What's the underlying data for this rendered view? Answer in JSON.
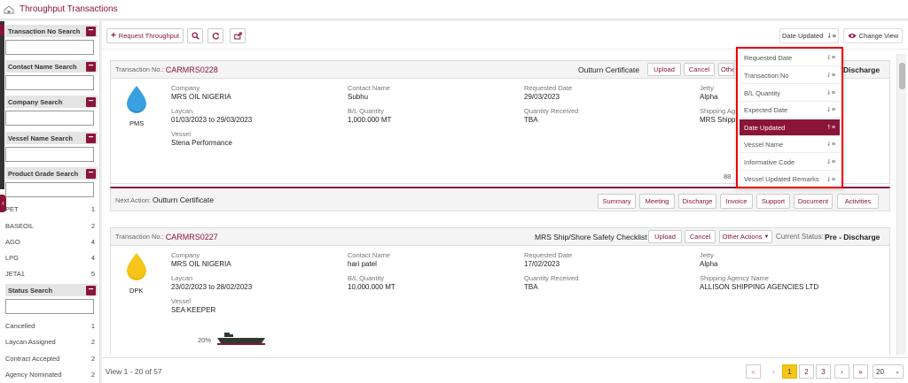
{
  "header": {
    "title": "Throughput Transactions"
  },
  "sidebar": {
    "filters": [
      {
        "label": "Transaction No Search"
      },
      {
        "label": "Contact Name Search"
      },
      {
        "label": "Company Search"
      },
      {
        "label": "Vessel Name Search"
      },
      {
        "label": "Product Grade Search"
      }
    ],
    "products": [
      {
        "name": "PET",
        "count": "1"
      },
      {
        "name": "BASEOIL",
        "count": "2"
      },
      {
        "name": "AGO",
        "count": "4"
      },
      {
        "name": "LPG",
        "count": "4"
      },
      {
        "name": "JETA1",
        "count": "5"
      }
    ],
    "status_search_label": "Status Search",
    "statuses": [
      {
        "name": "Cancelled",
        "count": "1"
      },
      {
        "name": "Laycan Assigned",
        "count": "2"
      },
      {
        "name": "Contract Accepted",
        "count": "2"
      },
      {
        "name": "Agency Nominated",
        "count": "2"
      }
    ]
  },
  "toolbar": {
    "request_label": "Request Throughput",
    "date_updated_label": "Date Updated",
    "change_view_label": "Change View"
  },
  "sort_menu": {
    "items": [
      {
        "label": "Requested Date"
      },
      {
        "label": "Transaction No"
      },
      {
        "label": "B/L Quantity"
      },
      {
        "label": "Expected Date"
      },
      {
        "label": "Date Updated"
      },
      {
        "label": "Vessel Name"
      },
      {
        "label": "Informative Code"
      },
      {
        "label": "Vessel Updated Remarks"
      }
    ]
  },
  "labels": {
    "transaction_no": "Transaction No.:",
    "company": "Company",
    "contact_name": "Contact Name",
    "requested_date": "Requested Date",
    "jetty": "Jetty",
    "laycan": "Laycan",
    "bl_quantity": "B/L Quantity",
    "quantity_received": "Quantity Received",
    "shipping_agency": "Shipping Agency Name",
    "shipping_agency_cut": "Shipping Ag",
    "vessel": "Vessel",
    "upload": "Upload",
    "cancel": "Cancel",
    "other": "Othe",
    "other_actions": "Other Actions",
    "current_status": "Current Status:",
    "next_action": "Next Action:"
  },
  "transactions": [
    {
      "tx_no": "CARMRS0228",
      "product": "PMS",
      "drop_color": "#3aa0e0",
      "company": "MRS OIL NIGERIA",
      "contact": "Subhu",
      "requested_date": "29/03/2023",
      "jetty": "Alpha",
      "laycan": "01/03/2023 to 29/03/2023",
      "bl_quantity": "1,000.000 MT",
      "quantity_received": "TBA",
      "shipping_agency": "MRS Shipp",
      "vessel": "Stena Performance",
      "action_title": "Outturn Certificate",
      "status_tail": "Discharge",
      "progress_text": "88",
      "next_action": "Outturn Certificate"
    },
    {
      "tx_no": "CARMRS0227",
      "product": "DPK",
      "drop_color": "#f5c518",
      "company": "MRS OIL NIGERIA",
      "contact": "hari patel",
      "requested_date": "17/02/2023",
      "jetty": "Alpha",
      "laycan": "23/02/2023 to 28/02/2023",
      "bl_quantity": "10,000.000 MT",
      "quantity_received": "TBA",
      "shipping_agency": "ALLISON SHIPPING AGENCIES LTD",
      "vessel": "SEA KEEPER",
      "action_title": "MRS Ship/Shore Safety Checklist",
      "status_value": "Pre - Discharge",
      "progress_text": "20%"
    }
  ],
  "action_buttons": [
    "Summary",
    "Meeting",
    "Discharge",
    "Invoice",
    "Support",
    "Document",
    "Activities"
  ],
  "footer": {
    "view_text": "View 1 - 20 of 57",
    "pages": [
      "1",
      "2",
      "3"
    ],
    "page_size": "20"
  }
}
